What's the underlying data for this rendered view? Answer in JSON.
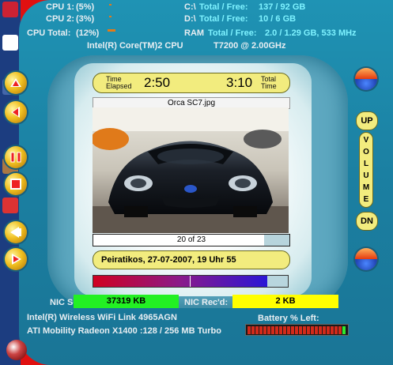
{
  "system": {
    "cpu1_label": "CPU 1:",
    "cpu1_value": "(5%)",
    "cpu2_label": "CPU 2:",
    "cpu2_value": "(3%)",
    "cpu_total_label": "CPU Total:",
    "cpu_total_value": "(12%)",
    "drive_c_label": "C:\\",
    "drive_c_text": "Total / Free:",
    "drive_c_value": "137 / 92 GB",
    "drive_d_label": "D:\\",
    "drive_d_text": "Total / Free:",
    "drive_d_value": "10 / 6 GB",
    "ram_label": "RAM",
    "ram_text": "Total / Free:",
    "ram_value": "2.0 / 1.29 GB, 533 MHz",
    "cpu_name": "Intel(R) Core(TM)2 CPU",
    "cpu_model": "T7200  @ 2.00GHz",
    "cpu1_level": 0.05,
    "cpu2_level": 0.03,
    "cpu_total_level": 0.12
  },
  "player": {
    "time_elapsed_label_1": "Time",
    "time_elapsed_label_2": "Elapsed",
    "time_elapsed": "2:50",
    "total_time": "3:10",
    "total_time_label_1": "Total",
    "total_time_label_2": "Time",
    "image_title": "Orca SC7.jpg",
    "counter": "20 of 23",
    "counter_current": 20,
    "counter_total": 23,
    "caption": "Peiratikos, 27-07-2007, 19 Uhr 55",
    "progress_fraction": 0.895
  },
  "volume": {
    "up_label": "UP",
    "down_label": "DN",
    "letters": [
      "V",
      "O",
      "L",
      "U",
      "M",
      "E"
    ]
  },
  "network": {
    "nic_send_label": "NIC Send:",
    "nic_send_value": "37319 KB",
    "nic_recd_label": "NIC Rec'd:",
    "nic_recd_value": "2 KB",
    "wifi": "Intel(R) Wireless WiFi Link 4965AGN",
    "gpu": "ATI Mobility Radeon X1400 :128 / 256 MB Turbo",
    "battery_label": "Battery % Left:",
    "battery_fraction": 0.85
  },
  "colors": {
    "send_green": "#23f023",
    "recd_yellow": "#ffff00",
    "skin_blue": "#1b84a6",
    "pill_yellow": "#f2ec7e",
    "frame_red": "#e01010"
  },
  "icons": [
    "triangle-up-icon",
    "triangle-left-icon",
    "pause-icon",
    "stop-icon",
    "arrow-left-icon",
    "play-icon",
    "orb-icon"
  ]
}
